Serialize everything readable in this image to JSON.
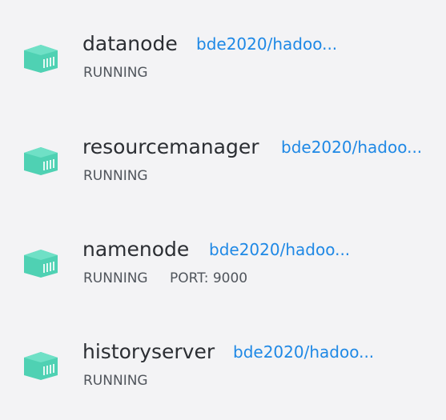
{
  "containers": [
    {
      "name": "datanode",
      "image": "bde2020/hadoo...",
      "status": "RUNNING",
      "port": ""
    },
    {
      "name": "resourcemanager",
      "image": "bde2020/hadoo...",
      "status": "RUNNING",
      "port": ""
    },
    {
      "name": "namenode",
      "image": "bde2020/hadoo...",
      "status": "RUNNING",
      "port": "PORT: 9000"
    },
    {
      "name": "historyserver",
      "image": "bde2020/hadoo...",
      "status": "RUNNING",
      "port": ""
    }
  ],
  "colors": {
    "icon": "#4fd1b3",
    "link": "#1e88e5",
    "name": "#2b2e33",
    "status": "#50555c",
    "background": "#f3f3f5"
  },
  "icon_name": "container-icon"
}
